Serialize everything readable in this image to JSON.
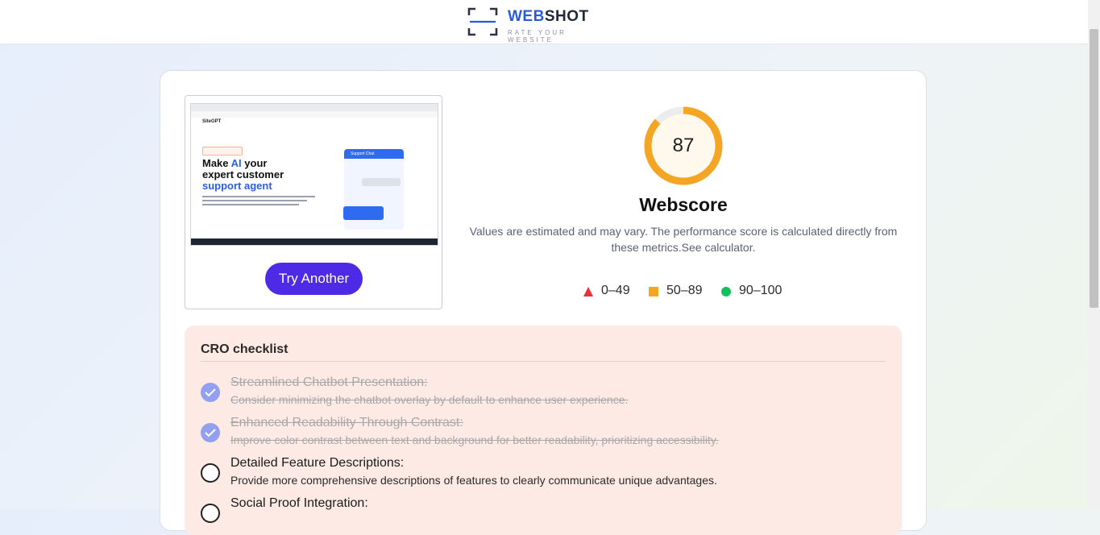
{
  "header": {
    "logo_part1": "WEB",
    "logo_part2": "SHOT",
    "logo_tagline": "RATE YOUR WEBSITE"
  },
  "preview": {
    "alt": "Website screenshot preview",
    "site_logo": "SiteGPT",
    "hero_line1": "Make ",
    "hero_accent": "AI",
    "hero_line1_end": " your",
    "hero_line2": "expert customer",
    "hero_line3": "support agent",
    "chat_header": "Support Chat",
    "try_another_label": "Try Another"
  },
  "score": {
    "value": 87,
    "max": 100,
    "label": "Webscore",
    "description": "Values are estimated and may vary. The performance score is calculated directly from these metrics.See calculator.",
    "ring_color": "#f5a524",
    "ring_fill": "#fff8ec"
  },
  "legend": [
    {
      "label": "0–49",
      "shape": "triangle",
      "color": "#e8313a"
    },
    {
      "label": "50–89",
      "shape": "square",
      "color": "#f5a524"
    },
    {
      "label": "90–100",
      "shape": "circle",
      "color": "#12c15c"
    }
  ],
  "checklist": {
    "title": "CRO checklist",
    "items": [
      {
        "title": "Streamlined Chatbot Presentation:",
        "description": "Consider minimizing the chatbot overlay by default to enhance user experience.",
        "done": true
      },
      {
        "title": "Enhanced Readability Through Contrast:",
        "description": "Improve color contrast between text and background for better readability, prioritizing accessibility.",
        "done": true
      },
      {
        "title": "Detailed Feature Descriptions:",
        "description": "Provide more comprehensive descriptions of features to clearly communicate unique advantages.",
        "done": false
      },
      {
        "title": "Social Proof Integration:",
        "description": "",
        "done": false
      }
    ]
  },
  "colors": {
    "accent": "#4c2ae6",
    "brand_blue": "#2a5bd7",
    "checklist_bg": "#fdeae4",
    "done_check": "#939fef"
  }
}
